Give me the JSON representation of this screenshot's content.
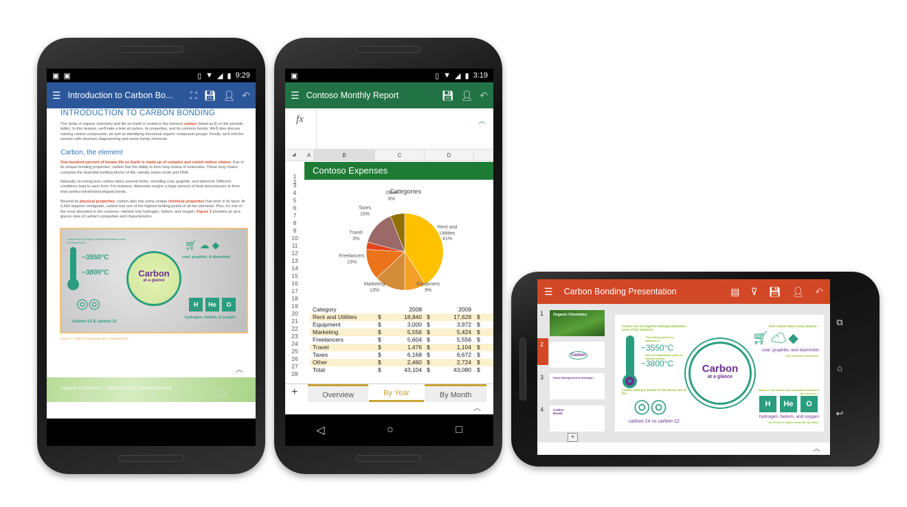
{
  "word": {
    "status": {
      "time": "9:29"
    },
    "title": "Introduction to Carbon Bo...",
    "heading": "INTRODUCTION TO CARBON BONDING",
    "para1_a": "The study of organic chemistry and life on Earth is rooted in the element ",
    "para1_carbon": "carbon",
    "para1_b": " (listed as ",
    "para1_c": "C",
    "para1_d": " on the periodic table). In this session, we'll take a look at carbon, its properties, and its common bonds. We'll also discuss naming carbon compounds, as well as identifying functional organic compound groups. Finally, we'll end the session with structure diagramming and some handy shortcuts.",
    "subheading": "Carbon, the element",
    "para2_bold": "One hundred percent of known life on Earth is made up of complex and varied carbon chains.",
    "para2_rest": " Due to its unique bonding properties, carbon has the ability to form long chains of molecules. These long chains comprise the essential building blocks of life, namely amino acids and DNA.",
    "para3": "Naturally occurring pure carbon takes several forms, including coal, graphite, and diamond. Different conditions lead to each form. For instance, diamonds require a large amount of heat and pressure to form their perfect tetrahedral-shaped bonds.",
    "para4_a": "Beyond its ",
    "para4_phys": "physical properties",
    "para4_b": ", carbon also has some unique ",
    "para4_chem": "chemical properties",
    "para4_c": " that work in its favor. At 3,500 degrees centigrade, carbon has one of the highest melting points of all the elements. Plus, it's one of the most abundant in the universe—behind only hydrogen, helium, and oxygen. ",
    "para4_fig": "Figure 1",
    "para4_d": " provides an at-a-glance view of carbon's properties and characteristics.",
    "caption": "Figure 1: Carbon's properties and characteristics",
    "footer": "Organic Chemistry – Introduction to Carbon Bonding"
  },
  "infographic": {
    "melt_note": "Carbon has the highest melting/sublimation point of the elements.",
    "diamond_note": "The melting point of a diamond is",
    "temp1": "~3550°C",
    "sub_note": "with the sublimation point of carbon around",
    "temp2": "~3800°C",
    "center_title": "Carbon",
    "center_sub": "at a glance",
    "shapes_note": "Pure carbon takes many shapes—",
    "forms": "coal, graphite, & diamonds",
    "forms_ppt": "coal, graphite, and diamonds",
    "forms_note": "are all carbon structures.",
    "dating_note": "Carbon dating is based on the decay rate of the",
    "isotopes": "carbon-14 & carbon-12",
    "isotopes_ppt": "carbon-14 vs carbon-12",
    "abundant_note": "Carbon is the fourth most abundant element in the universe—",
    "elements": [
      "H",
      "He",
      "O"
    ],
    "elements_nums": [
      "1",
      "2",
      "8"
    ],
    "elements_text": "hydrogen, helium, & oxygen",
    "elements_text_ppt": "hydrogen, helium, and oxygen",
    "elements_note": "are found in higher amounts, by mass."
  },
  "excel": {
    "status": {
      "time": "3:19"
    },
    "title": "Contoso Monthly Report",
    "fx": "fx",
    "columns": [
      "A",
      "B",
      "C",
      "D"
    ],
    "sheet_title": "Contoso Expenses",
    "rows": [
      "1",
      "2",
      "3",
      "4",
      "5",
      "6",
      "7",
      "8",
      "9",
      "10",
      "11",
      "12",
      "13",
      "14",
      "15",
      "16",
      "17",
      "18",
      "19",
      "20",
      "21",
      "22",
      "23",
      "24",
      "25",
      "26",
      "27",
      "28"
    ],
    "table": {
      "header": [
        "Category",
        "2008",
        "2009"
      ],
      "currency": "$",
      "rows": [
        [
          "Rent and Utilities",
          "18,840",
          "17,628"
        ],
        [
          "Equipment",
          "3,000",
          "3,972"
        ],
        [
          "Marketing",
          "5,556",
          "5,424"
        ],
        [
          "Freelancers",
          "5,604",
          "5,556"
        ],
        [
          "Travel",
          "1,476",
          "1,104"
        ],
        [
          "Taxes",
          "6,168",
          "6,672"
        ],
        [
          "Other",
          "2,460",
          "2,724"
        ],
        [
          "Total",
          "43,104",
          "43,080"
        ]
      ]
    },
    "tabs": [
      "Overview",
      "By Year",
      "By Month"
    ],
    "active_tab": "By Year",
    "add_sheet": "+"
  },
  "chart_data": {
    "type": "pie",
    "title": "Categories",
    "slices": [
      {
        "label": "Rent and Utilities",
        "pct": "41%",
        "value": 41,
        "color": "#ffc000"
      },
      {
        "label": "Equipment",
        "pct": "9%",
        "value": 9,
        "color": "#f5a028"
      },
      {
        "label": "Marketing",
        "pct": "13%",
        "value": 13,
        "color": "#d38c38"
      },
      {
        "label": "Freelancers",
        "pct": "13%",
        "value": 13,
        "color": "#eb7319"
      },
      {
        "label": "Travel",
        "pct": "3%",
        "value": 3,
        "color": "#e4441d"
      },
      {
        "label": "Taxes",
        "pct": "15%",
        "value": 15,
        "color": "#9b6a68"
      },
      {
        "label": "Other",
        "pct": "6%",
        "value": 6,
        "color": "#8e7100"
      }
    ]
  },
  "powerpoint": {
    "title": "Carbon Bonding Presentation",
    "slides": [
      {
        "num": "1",
        "title": "Organic Chemistry"
      },
      {
        "num": "2",
        "title": "Carbon"
      },
      {
        "num": "3",
        "title": "Some Background Knowledge..."
      },
      {
        "num": "4",
        "title": "Carbon Bonds"
      }
    ],
    "selected_slide": "2",
    "add_slide": "+"
  },
  "colors": {
    "word": "#2b579a",
    "excel": "#217346",
    "powerpoint": "#d24726"
  }
}
